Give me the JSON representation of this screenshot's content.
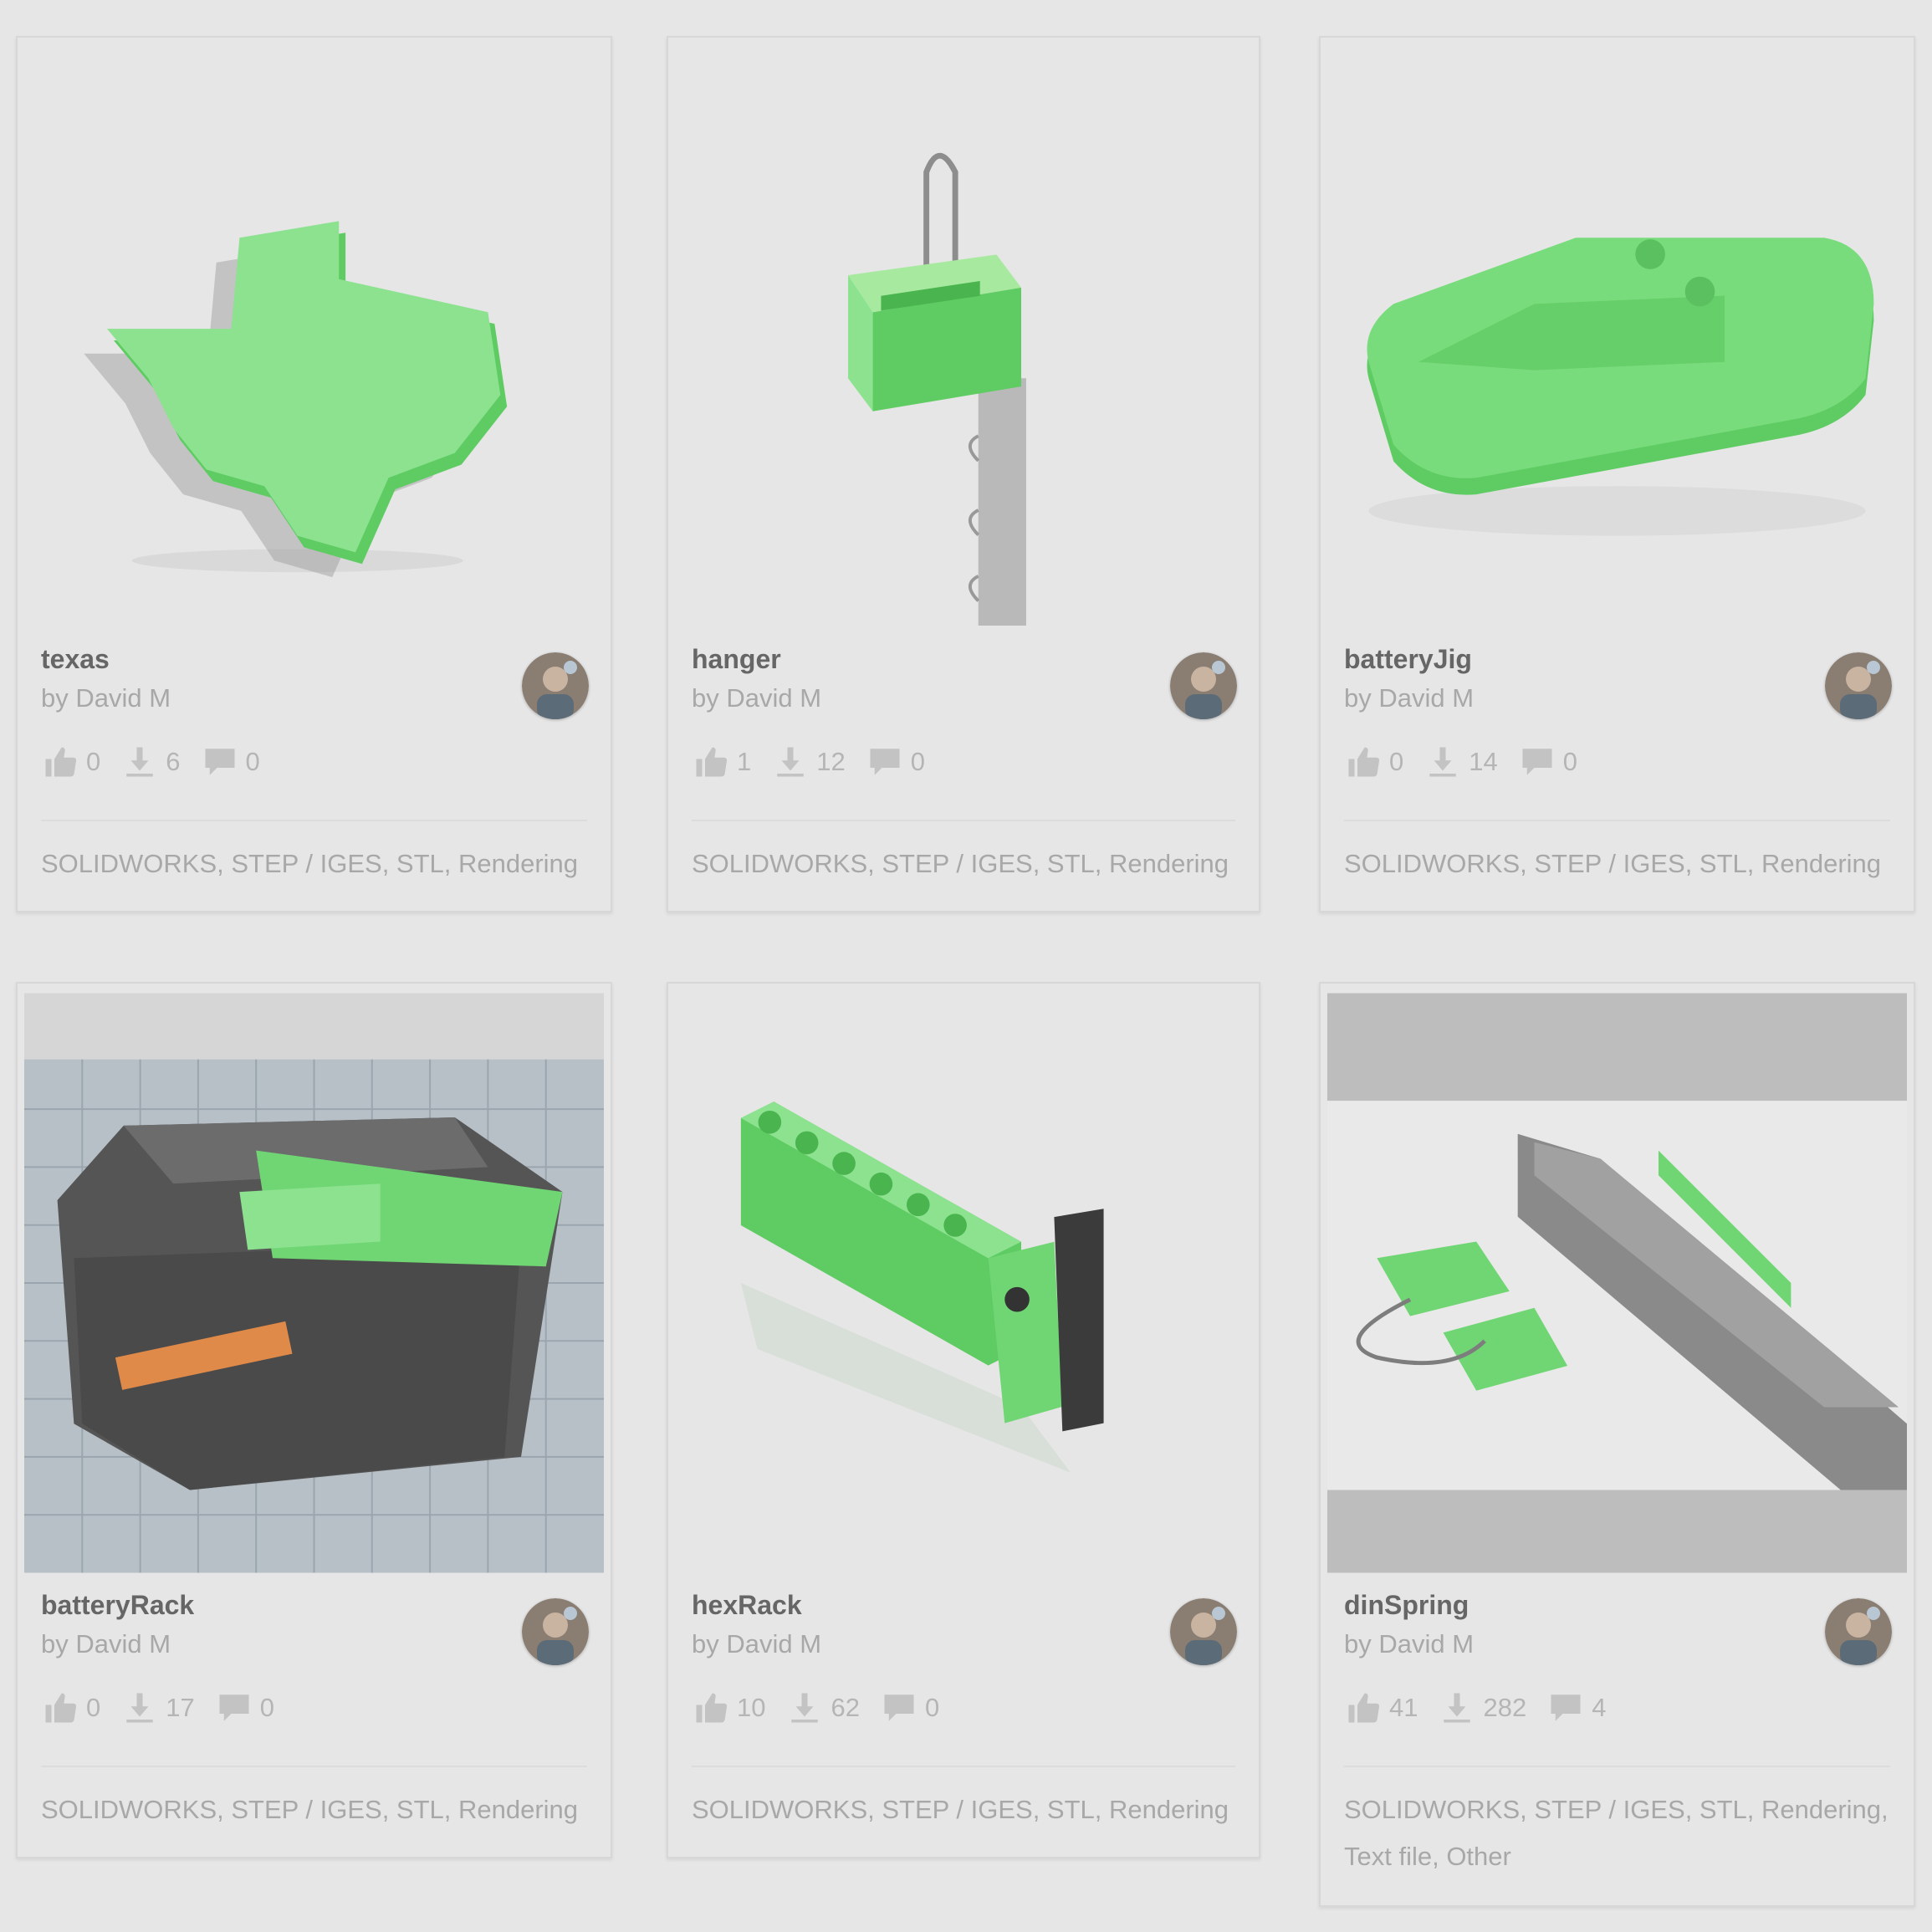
{
  "cards": [
    {
      "title": "texas",
      "author": "by David M",
      "likes": "0",
      "downloads": "6",
      "comments": "0",
      "formats": "SOLIDWORKS, STEP / IGES, STL, Rendering",
      "image": "texas-model-render"
    },
    {
      "title": "hanger",
      "author": "by David M",
      "likes": "1",
      "downloads": "12",
      "comments": "0",
      "formats": "SOLIDWORKS, STEP / IGES, STL, Rendering",
      "image": "hanger-model-render"
    },
    {
      "title": "batteryJig",
      "author": "by David M",
      "likes": "0",
      "downloads": "14",
      "comments": "0",
      "formats": "SOLIDWORKS, STEP / IGES, STL, Rendering",
      "image": "battery-jig-model-render"
    },
    {
      "title": "batteryRack",
      "author": "by David M",
      "likes": "0",
      "downloads": "17",
      "comments": "0",
      "formats": "SOLIDWORKS, STEP / IGES, STL, Rendering",
      "image": "battery-rack-photo"
    },
    {
      "title": "hexRack",
      "author": "by David M",
      "likes": "10",
      "downloads": "62",
      "comments": "0",
      "formats": "SOLIDWORKS, STEP / IGES, STL, Rendering",
      "image": "hex-rack-model-render"
    },
    {
      "title": "dinSpring",
      "author": "by David M",
      "likes": "41",
      "downloads": "282",
      "comments": "4",
      "formats": "SOLIDWORKS, STEP / IGES, STL, Rendering, Text file, Other",
      "image": "din-spring-model-render"
    }
  ],
  "icons": {
    "like": "thumbs-up-icon",
    "download": "download-icon",
    "comment": "comment-icon"
  },
  "colors": {
    "background": "#e6e6e6",
    "model_green": "#6fd673",
    "meta_text": "#a8a8a8",
    "title_text": "#666666"
  }
}
